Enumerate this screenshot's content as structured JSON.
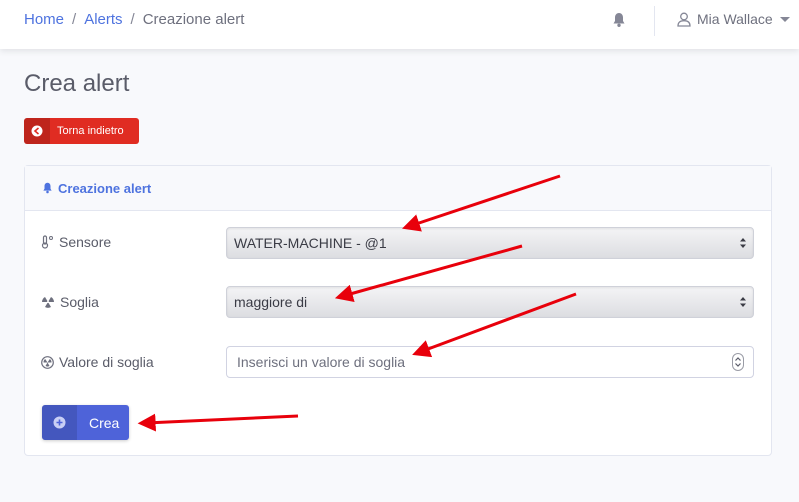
{
  "breadcrumb": {
    "home": "Home",
    "separator": "/",
    "alerts": "Alerts",
    "current": "Creazione alert"
  },
  "topbar": {
    "notification_icon": "bell-icon",
    "user_name": "Mia Wallace",
    "user_icon": "user-icon"
  },
  "page": {
    "title": "Crea alert"
  },
  "back_button": {
    "label": "Torna indietro",
    "icon": "arrow-left-circle-icon",
    "color": "#e02c22"
  },
  "card": {
    "title": "Creazione alert",
    "title_icon": "bell-icon",
    "accent": "#4e73df"
  },
  "form": {
    "sensor": {
      "label": "Sensore",
      "icon": "thermometer-icon",
      "value": "WATER-MACHINE - @1"
    },
    "threshold": {
      "label": "Soglia",
      "icon": "radiation-icon",
      "value": "maggiore di"
    },
    "threshold_value": {
      "label": "Valore di soglia",
      "icon": "radiation-circle-icon",
      "placeholder": "Inserisci un valore di soglia",
      "value": ""
    },
    "submit": {
      "label": "Crea",
      "icon": "plus-circle-icon",
      "color": "#4e63d9"
    }
  },
  "annotation_color": "#e8000b"
}
